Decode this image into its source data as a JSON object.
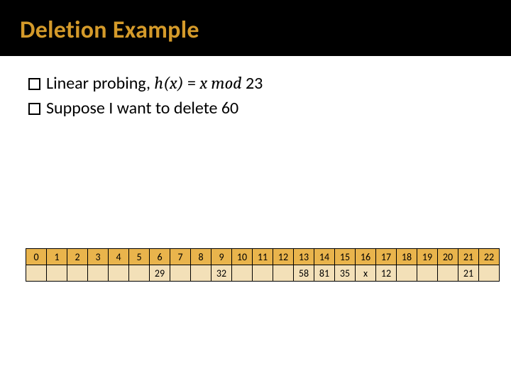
{
  "title": "Deletion Example",
  "bullets": [
    {
      "prefix": "Linear probing, ",
      "formula_lhs": "h(x)",
      "eq": " = ",
      "formula_rhs": "x mod",
      "tail": " 23"
    },
    {
      "text": "Suppose I want to delete 60"
    }
  ],
  "indices": [
    "0",
    "1",
    "2",
    "3",
    "4",
    "5",
    "6",
    "7",
    "8",
    "9",
    "10",
    "11",
    "12",
    "13",
    "14",
    "15",
    "16",
    "17",
    "18",
    "19",
    "20",
    "21",
    "22"
  ],
  "values": [
    "",
    "",
    "",
    "",
    "",
    "",
    "29",
    "",
    "",
    "32",
    "",
    "",
    "",
    "58",
    "81",
    "35",
    "x",
    "12",
    "",
    "",
    "",
    "21",
    ""
  ]
}
